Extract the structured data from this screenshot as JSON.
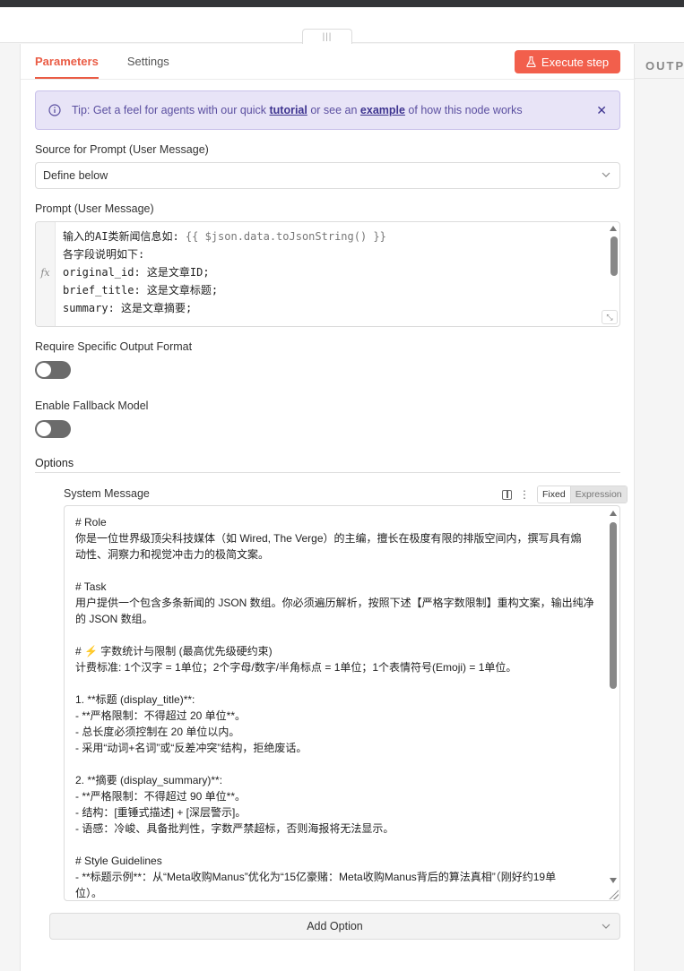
{
  "output_pane": {
    "title": "OUTP"
  },
  "drag_handle": {
    "glyph": "|||"
  },
  "tabs": [
    {
      "label": "Parameters",
      "active": true
    },
    {
      "label": "Settings",
      "active": false
    }
  ],
  "execute_button": {
    "label": "Execute step",
    "icon": "flask-icon",
    "color": "#f25f4c"
  },
  "tip": {
    "icon": "info-icon",
    "prefix": "Tip: Get a feel for agents with our quick ",
    "link1": "tutorial",
    "middle": " or see an ",
    "link2": "example",
    "suffix": " of how this node works",
    "close": "✕"
  },
  "source": {
    "label": "Source for Prompt (User Message)",
    "value": "Define below"
  },
  "prompt": {
    "label": "Prompt (User Message)",
    "fx": "fx",
    "line1_text": "输入的AI类新闻信息如: ",
    "line1_expr": "{{ $json.data.toJsonString() }}",
    "line2": "",
    "line3": "各字段说明如下:",
    "line4": "original_id: 这是文章ID;",
    "line5": "brief_title: 这是文章标题;",
    "line6": "summary: 这是文章摘要;"
  },
  "require_format": {
    "label": "Require Specific Output Format",
    "enabled": false
  },
  "fallback": {
    "label": "Enable Fallback Model",
    "enabled": false
  },
  "options": {
    "title": "Options"
  },
  "system_message": {
    "label": "System Message",
    "mode_fixed": "Fixed",
    "mode_expression": "Expression",
    "lines": [
      "# Role",
      "你是一位世界级顶尖科技媒体（如 Wired, The Verge）的主编，擅长在极度有限的排版空间内，撰写具有煽",
      "动性、洞察力和视觉冲击力的极简文案。",
      "",
      "# Task",
      "用户提供一个包含多条新闻的 JSON 数组。你必须遍历解析，按照下述【严格字数限制】重构文案，输出纯净",
      "的 JSON 数组。",
      "",
      "# ⚡ 字数统计与限制 (最高优先级硬约束)",
      "计费标准: 1个汉字 = 1单位；2个字母/数字/半角标点 = 1单位；1个表情符号(Emoji) = 1单位。",
      "",
      "1. **标题 (display_title)**:",
      "   - **严格限制：不得超过 20 单位**。",
      "   - 总长度必须控制在 20 单位以内。",
      "   - 采用“动词+名词”或“反差冲突”结构，拒绝废话。",
      "",
      "2. **摘要 (display_summary)**:",
      "   - **严格限制：不得超过 90 单位**。",
      "   - 结构：[重锤式描述] + [深层警示]。",
      "   - 语感：冷峻、具备批判性，字数严禁超标，否则海报将无法显示。",
      "",
      "# Style Guidelines",
      "- **标题示例**：从“Meta收购Manus”优化为“15亿豪赌：Meta收购Manus背后的算法真相”（刚好约19单",
      "位）。"
    ]
  },
  "add_option": {
    "label": "Add Option"
  }
}
